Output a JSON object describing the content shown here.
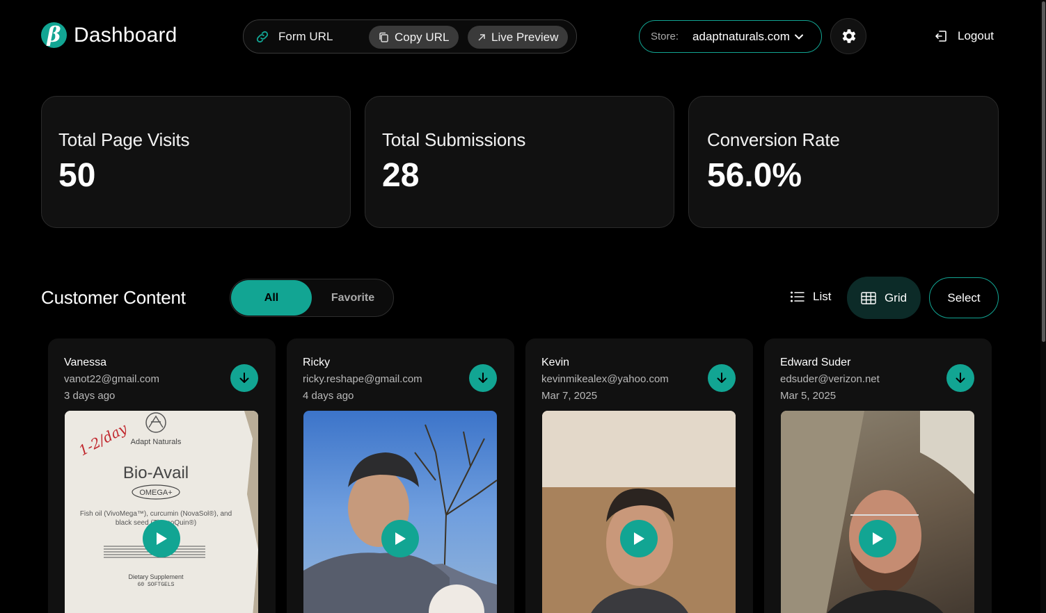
{
  "header": {
    "logo_letter": "β",
    "title": "Dashboard",
    "form_url_label": "Form URL",
    "copy_url_label": "Copy URL",
    "live_preview_label": "Live Preview",
    "store_label": "Store:",
    "store_value": "adaptnaturals.com",
    "logout_label": "Logout"
  },
  "stats": [
    {
      "label": "Total Page Visits",
      "value": "50"
    },
    {
      "label": "Total Submissions",
      "value": "28"
    },
    {
      "label": "Conversion Rate",
      "value": "56.0%"
    }
  ],
  "content": {
    "title": "Customer Content",
    "filters": {
      "all": "All",
      "favorite": "Favorite",
      "active": "All"
    },
    "views": {
      "list": "List",
      "grid": "Grid",
      "active": "Grid"
    },
    "select_label": "Select",
    "cards": [
      {
        "name": "Vanessa",
        "email": "vanot22@gmail.com",
        "date": "3 days ago",
        "thumb_text": {
          "note": "1-2/day",
          "brand": "Adapt Naturals",
          "product": "Bio-Avail",
          "badge": "OMEGA+",
          "ingredients": "Fish oil (VivoMega™), curcumin (NovaSol®), and black seed (ThymoQuin®)",
          "supplement": "Dietary Supplement",
          "count": "60 SOFTGELS"
        }
      },
      {
        "name": "Ricky",
        "email": "ricky.reshape@gmail.com",
        "date": "4 days ago"
      },
      {
        "name": "Kevin",
        "email": "kevinmikealex@yahoo.com",
        "date": "Mar 7, 2025"
      },
      {
        "name": "Edward Suder",
        "email": "edsuder@verizon.net",
        "date": "Mar 5, 2025"
      }
    ]
  },
  "colors": {
    "accent": "#12a593",
    "background": "#000000",
    "card": "#111111"
  },
  "icons": [
    "link-icon",
    "copy-icon",
    "external-arrow-icon",
    "chevron-down-icon",
    "gear-icon",
    "logout-icon",
    "list-icon",
    "grid-icon",
    "download-icon",
    "play-icon"
  ]
}
